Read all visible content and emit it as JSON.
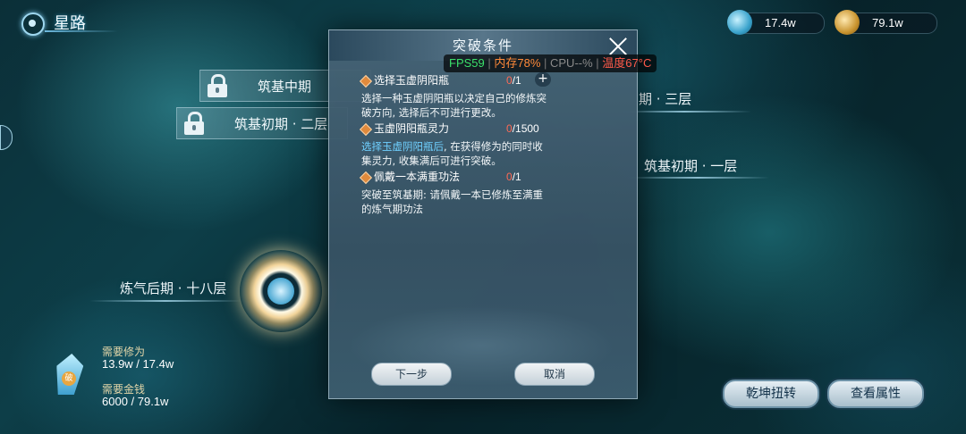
{
  "header": {
    "title": "星路"
  },
  "resources": {
    "cultivation": "17.4w",
    "gold": "79.1w"
  },
  "stages": {
    "locked_upper": "筑基中期",
    "locked_lower": "筑基初期 · 二层",
    "right_upper": "期 · 三层",
    "right_lower": "筑基初期 · 一层",
    "current": "炼气后期 · 十八层"
  },
  "requirements": {
    "cultivation_label": "需要修为",
    "cultivation_value": "13.9w / 17.4w",
    "gold_label": "需要金钱",
    "gold_value": "6000 / 79.1w"
  },
  "actions": {
    "rotate": "乾坤扭转",
    "view_attributes": "查看属性"
  },
  "modal": {
    "title": "突破条件",
    "items": [
      {
        "name": "选择玉虚阴阳瓶",
        "current": "0",
        "total": "/1",
        "desc": "选择一种玉虚阴阳瓶以决定自己的修炼突破方向, 选择后不可进行更改。"
      },
      {
        "name": "玉虚阴阳瓶灵力",
        "current": "0",
        "total": "/1500",
        "desc_highlight": "选择玉虚阴阳瓶后",
        "desc": ", 在获得修为的同时收集灵力, 收集满后可进行突破。"
      },
      {
        "name": "佩戴一本满重功法",
        "current": "0",
        "total": "/1",
        "desc": "突破至筑基期: 请佩戴一本已修炼至满重的炼气期功法"
      }
    ],
    "next_button": "下一步",
    "cancel_button": "取消"
  },
  "fps_overlay": {
    "fps": "FPS59",
    "memory": "内存78%",
    "cpu": "CPU--%",
    "temperature": "温度67°C"
  }
}
